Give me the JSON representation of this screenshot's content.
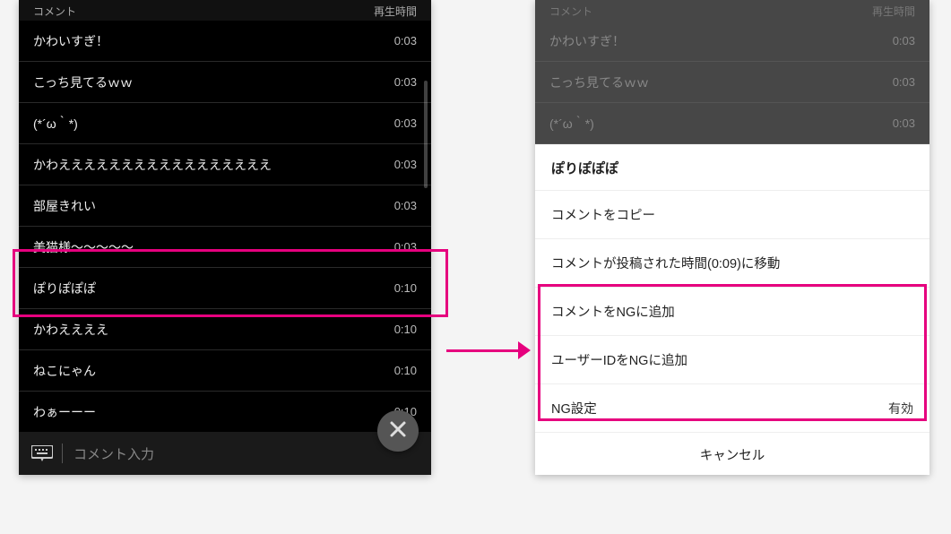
{
  "left": {
    "header_comment": "コメント",
    "header_time": "再生時間",
    "rows": [
      {
        "text": "かわいすぎ！",
        "time": "0:03"
      },
      {
        "text": "こっち見てるｗｗ",
        "time": "0:03"
      },
      {
        "text": "(*´ω｀*)",
        "time": "0:03"
      },
      {
        "text": "かわえええええええええええええええええ",
        "time": "0:03"
      },
      {
        "text": "部屋きれい",
        "time": "0:03"
      },
      {
        "text": "美猫様～～～～～",
        "time": "0:03"
      },
      {
        "text": "ぽりぽぽぽ",
        "time": "0:10"
      },
      {
        "text": "かわええええ",
        "time": "0:10"
      },
      {
        "text": "ねこにゃん",
        "time": "0:10"
      },
      {
        "text": "わぁーーー",
        "time": "0:10"
      }
    ],
    "input_placeholder": "コメント入力"
  },
  "right": {
    "header_comment": "コメント",
    "header_time": "再生時間",
    "dim_rows": [
      {
        "text": "かわいすぎ！",
        "time": "0:03"
      },
      {
        "text": "こっち見てるｗｗ",
        "time": "0:03"
      },
      {
        "text": "(*´ω｀*)",
        "time": "0:03"
      }
    ],
    "sheet": {
      "title": "ぽりぽぽぽ",
      "copy": "コメントをコピー",
      "jump": "コメントが投稿された時間(0:09)に移動",
      "ng_comment": "コメントをNGに追加",
      "ng_user": "ユーザーIDをNGに追加",
      "ng_setting_label": "NG設定",
      "ng_setting_status": "有効",
      "cancel": "キャンセル"
    }
  }
}
